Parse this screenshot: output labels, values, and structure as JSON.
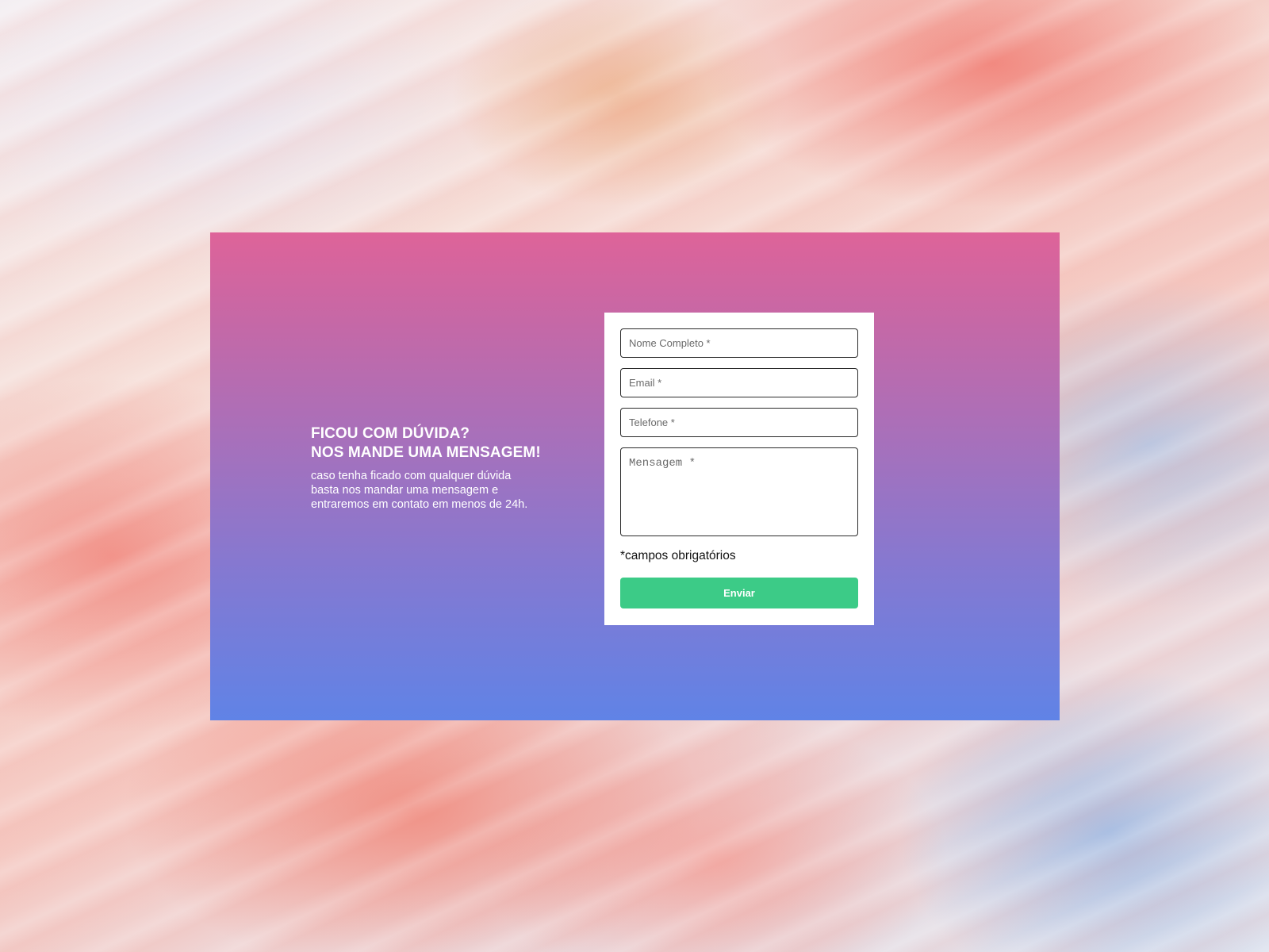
{
  "contact": {
    "heading_line1": "FICOU COM DÚVIDA?",
    "heading_line2": "NOS MANDE UMA MENSAGEM!",
    "description_line1": "caso tenha ficado com qualquer dúvida",
    "description_line2": "basta nos mandar uma mensagem e",
    "description_line3": "entraremos em contato em menos de 24h."
  },
  "form": {
    "name_placeholder": "Nome Completo *",
    "email_placeholder": "Email *",
    "phone_placeholder": "Telefone *",
    "message_placeholder": "Mensagem *",
    "required_note": "*campos obrigatórios",
    "submit_label": "Enviar"
  },
  "colors": {
    "gradient_top": "#de6399",
    "gradient_bottom": "#6083e6",
    "submit_button": "#3ccb87"
  }
}
